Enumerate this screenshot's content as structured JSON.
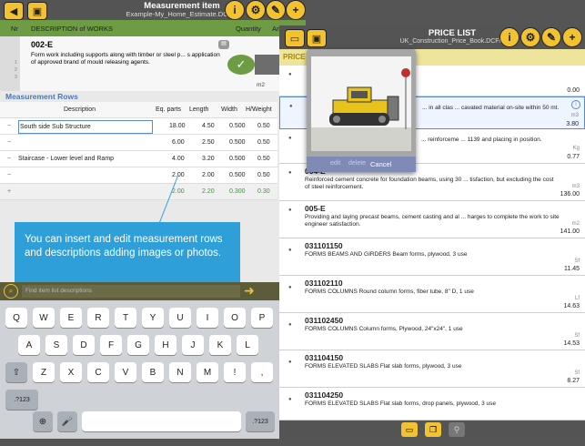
{
  "left_header": {
    "title": "Measurement item",
    "subtitle": "Example-My_Home_Estimate.DCFm"
  },
  "col_header": {
    "nr": "Nr",
    "desc": "DESCRIPTION of WORKS",
    "qty": "Quantity",
    "am": "Am"
  },
  "item": {
    "code": "002-E",
    "text": "Form work including supports along with timber or steel p... s application of approved brand of mould releasing agents.",
    "unit": "m2",
    "seq": [
      "1",
      "2",
      "3"
    ]
  },
  "measurement": {
    "label": "Measurement Rows",
    "headers": [
      "Description",
      "Eq. parts",
      "Length",
      "Width",
      "H/Weight"
    ],
    "rows": [
      {
        "desc": "South side Sub Structure",
        "eq": "18.00",
        "len": "4.50",
        "wid": "0.500",
        "h": "0.50"
      },
      {
        "desc": "",
        "eq": "6.00",
        "len": "2.50",
        "wid": "0.500",
        "h": "0.50"
      },
      {
        "desc": "Staircase - Lower level and Ramp",
        "eq": "4.00",
        "len": "3.20",
        "wid": "0.500",
        "h": "0.50"
      },
      {
        "desc": "",
        "eq": "2.00",
        "len": "2.00",
        "wid": "0.500",
        "h": "0.50"
      },
      {
        "desc": "",
        "eq": "2.00",
        "len": "2.20",
        "wid": "0.300",
        "h": "0.30"
      }
    ]
  },
  "tooltip": "You can insert and edit measurement rows and descriptions adding images or photos.",
  "search_placeholder": "Find item list descriptions",
  "keyboard": {
    "row1": [
      "Q",
      "W",
      "E",
      "R",
      "T",
      "Y",
      "U",
      "I",
      "O",
      "P"
    ],
    "row2": [
      "A",
      "S",
      "D",
      "F",
      "G",
      "H",
      "J",
      "K",
      "L"
    ],
    "row3": [
      "Z",
      "X",
      "C",
      "V",
      "B",
      "N",
      "M",
      "!",
      ","
    ],
    "row3_sub": [
      "",
      "",
      "",
      "",
      "",
      "",
      "",
      "!",
      "'"
    ],
    "bottom": {
      "num": ".?123",
      "globe": "⊕",
      "mic": "🎤",
      "num2": ".?123"
    },
    "shift": "⇧",
    "backspace": "⌫"
  },
  "price_header": {
    "title": "PRICE LIST",
    "subtitle": "UK_Construction_Price_Book.DCFm",
    "tab": "PRICE"
  },
  "photo_popup": {
    "edit": "edit",
    "delete": "delete",
    "cancel": "Cancel"
  },
  "price_items": [
    {
      "code": "",
      "text": "",
      "unit": "",
      "price": "0.00"
    },
    {
      "code": "",
      "text": "... in all clas ... cavated material on-site within 50 mt.",
      "unit": "m3",
      "price": "3.80"
    },
    {
      "code": "",
      "text": "... reinforceme ... 1139 and placing in position.",
      "unit": "Kg",
      "price": "0.77"
    },
    {
      "code": "004-E",
      "text": "Reinforced cement concrete for foundation beams, using 30 ... tisfaction, but excluding the cost of steel reinforcement.",
      "unit": "m3",
      "price": "136.00"
    },
    {
      "code": "005-E",
      "text": "Providing and laying precast beams, cement casting and al ... harges to complete the work to site engineer satisfaction.",
      "unit": "m2",
      "price": "141.00"
    },
    {
      "code": "031101150",
      "text": "FORMS BEAMS AND GIRDERS Beam forms, plywood, 3 use",
      "unit": "Sf",
      "price": "11.45"
    },
    {
      "code": "031102110",
      "text": "FORMS COLUMNS Round column forms, fiber tube, 8\" D, 1 use",
      "unit": "Lf",
      "price": "14.63"
    },
    {
      "code": "031102450",
      "text": "FORMS COLUMNS Column forms, Plywood, 24\"x24\", 1 use",
      "unit": "Sf",
      "price": "14.53"
    },
    {
      "code": "031104150",
      "text": "FORMS ELEVATED SLABS Flat slab forms, plywood, 3 use",
      "unit": "Sf",
      "price": "8.27"
    },
    {
      "code": "031104250",
      "text": "FORMS ELEVATED SLABS Flat slab forms, drop panels, plywood, 3 use",
      "unit": "",
      "price": ""
    }
  ],
  "colors": {
    "header": "#545454",
    "accent": "#f2c230",
    "green": "#6d9c44",
    "tooltip": "#2e9fd8",
    "blue_label": "#4a78b8"
  }
}
